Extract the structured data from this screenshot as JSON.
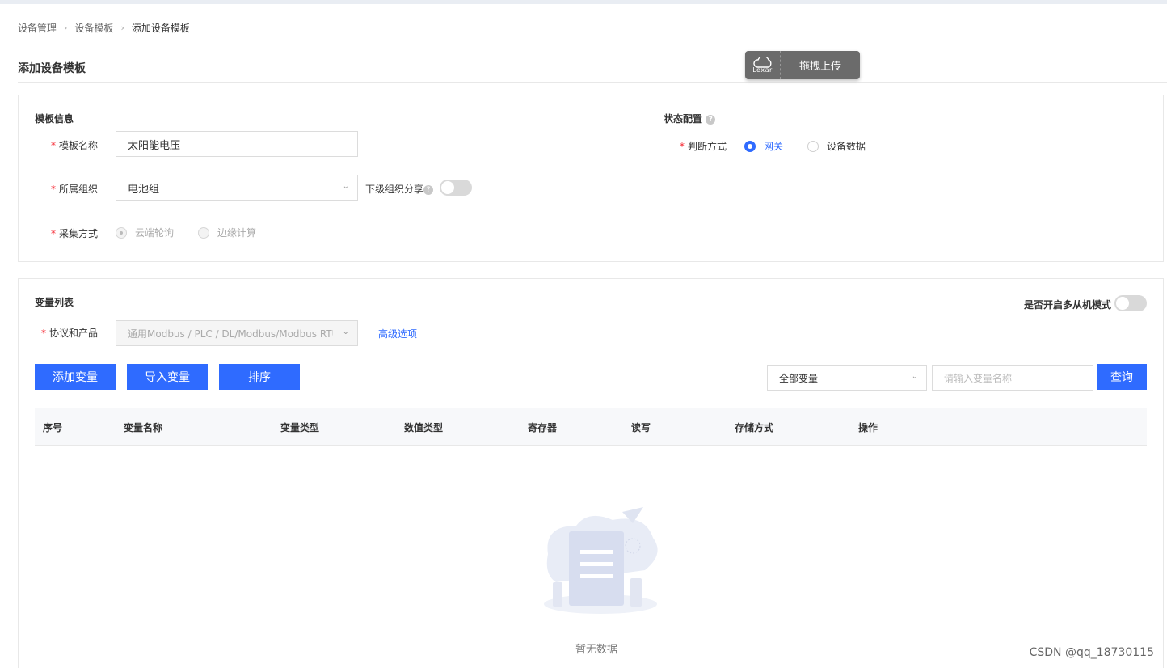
{
  "breadcrumb": [
    "设备管理",
    "设备模板",
    "添加设备模板"
  ],
  "page_title": "添加设备模板",
  "overlay": {
    "logo_text": "Lexar",
    "upload_label": "拖拽上传"
  },
  "template_info": {
    "title": "模板信息",
    "name_label": "模板名称",
    "name_value": "太阳能电压",
    "org_label": "所属组织",
    "org_value": "电池组",
    "sub_share_label": "下级组织分享",
    "sub_share_on": false,
    "collect_label": "采集方式",
    "collect_options": [
      "云端轮询",
      "边缘计算"
    ],
    "collect_selected": "云端轮询"
  },
  "status_config": {
    "title": "状态配置",
    "judge_label": "判断方式",
    "judge_options": [
      "网关",
      "设备数据"
    ],
    "judge_selected": "网关"
  },
  "variables": {
    "title": "变量列表",
    "multi_slave_label": "是否开启多从机模式",
    "multi_slave_on": false,
    "protocol_label": "协议和产品",
    "protocol_value": "通用Modbus / PLC / DL/Modbus/Modbus RTU",
    "advanced_link": "高级选项",
    "buttons": [
      "添加变量",
      "导入变量",
      "排序"
    ],
    "filter_value": "全部变量",
    "search_placeholder": "请输入变量名称",
    "query_label": "查询",
    "columns": [
      "序号",
      "变量名称",
      "变量类型",
      "数值类型",
      "寄存器",
      "读写",
      "存储方式",
      "操作"
    ],
    "rows": [],
    "empty_text": "暂无数据"
  },
  "watermark": "CSDN @qq_18730115",
  "colors": {
    "primary": "#2f6bff",
    "required": "#f5222d"
  }
}
